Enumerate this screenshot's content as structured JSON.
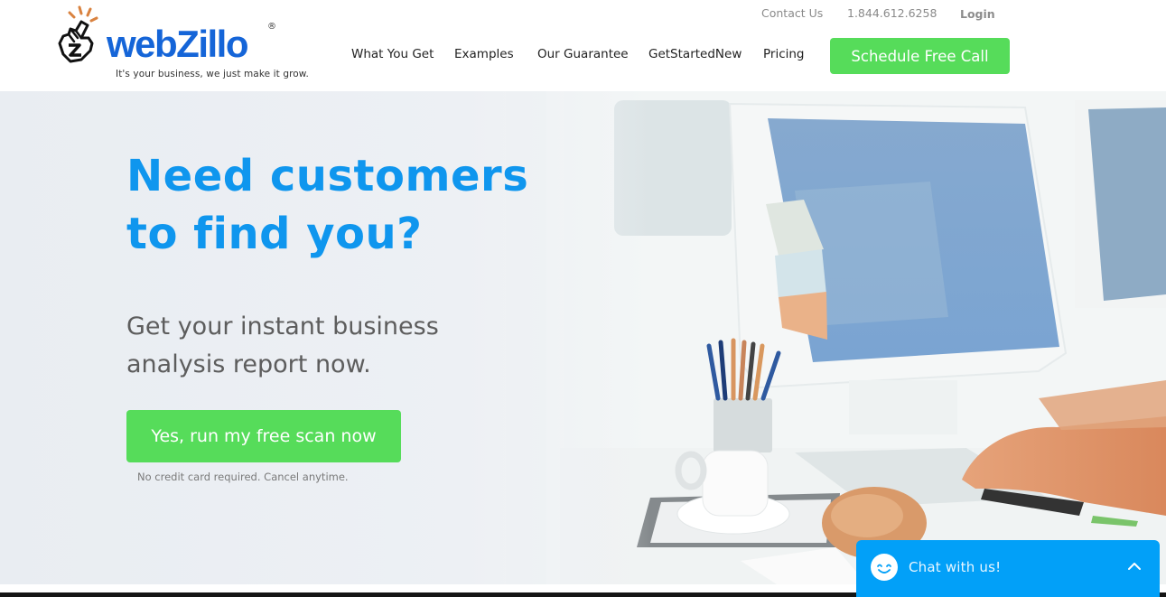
{
  "header": {
    "logo": {
      "wordmark": "webZillo",
      "registered": "®",
      "tagline": "It's your business, we just make it grow.",
      "icon": "pointing-hand-icon"
    },
    "utility_links": {
      "contact": "Contact Us",
      "phone": "1.844.612.6258",
      "login": "Login"
    },
    "nav": [
      {
        "label": "What You Get"
      },
      {
        "label": "Examples"
      },
      {
        "label": "Our Guarantee"
      },
      {
        "label": "GetStartedNew"
      },
      {
        "label": "Pricing"
      }
    ],
    "cta_label": "Schedule Free Call"
  },
  "hero": {
    "headline_lines": [
      "Need customers",
      "to find you?"
    ],
    "subhead_lines": [
      "Get your instant business",
      "analysis report now."
    ],
    "cta_label": "Yes, run my free scan now",
    "disclaimer": "No credit card required. Cancel anytime.",
    "background_image": "office-desk-computer-photo"
  },
  "chat_widget": {
    "label": "Chat with us!",
    "icon": "smiley-icon",
    "toggle_icon": "chevron-up-icon"
  },
  "colors": {
    "brand_blue": "#1565d8",
    "headline_blue": "#0f96ee",
    "cta_green": "#56dc5a",
    "chat_blue": "#02a0f8",
    "logo_accent_orange": "#d9823f"
  }
}
